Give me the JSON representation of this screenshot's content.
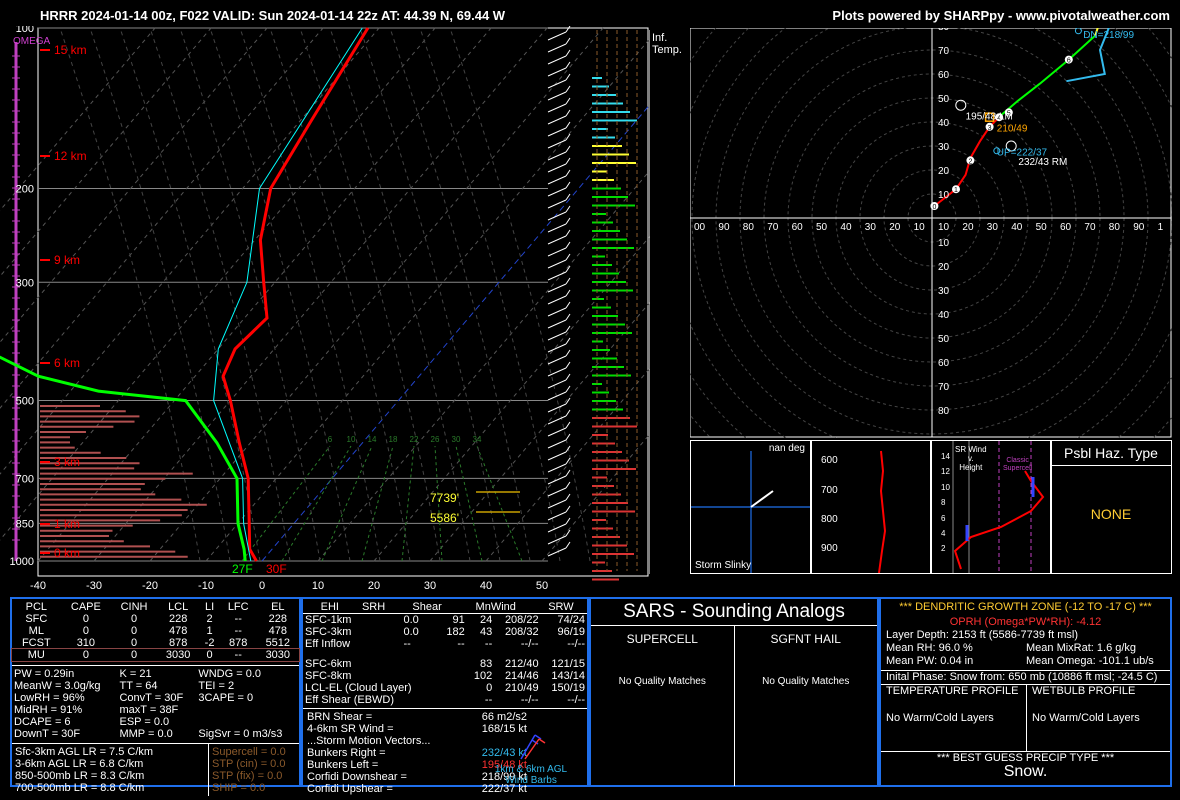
{
  "header": {
    "title": "HRRR 2024-01-14 00z, F022  VALID: Sun 2024-01-14 22z  AT: 44.39 N, 69.44 W",
    "credit": "Plots powered by SHARPpy - www.pivotalweather.com"
  },
  "skewt": {
    "omega_label": "OMEGA",
    "pressure_labels": [
      "100",
      "200",
      "300",
      "500",
      "700",
      "850",
      "1000"
    ],
    "height_labels": [
      "15 km",
      "12 km",
      "9 km",
      "6 km",
      "3 km",
      "1 km",
      "0 km"
    ],
    "temp_ticks": [
      "-40",
      "-30",
      "-20",
      "-10",
      "0",
      "10",
      "20",
      "30",
      "40",
      "50"
    ],
    "sfc_td": "27F",
    "sfc_t": "30F",
    "dgz_top": "7739'",
    "dgz_bottom": "5586'",
    "mixing_ratio_labels": [
      "6",
      "10",
      "14",
      "18",
      "22",
      "26",
      "30",
      "34"
    ]
  },
  "inferred_temp": {
    "title_line1": "Inf.",
    "title_line2": "Temp.",
    "values": [
      "3.5",
      "1.5",
      "3.1",
      "0.4",
      "3.9",
      "0.3",
      "-0.0",
      "0.6"
    ]
  },
  "hodograph": {
    "x_ticks": [
      "00",
      "90",
      "80",
      "70",
      "60",
      "50",
      "40",
      "30",
      "20",
      "10",
      "10",
      "20",
      "30",
      "40",
      "50",
      "60",
      "70",
      "80",
      "90",
      "1"
    ],
    "y_ticks": [
      "80",
      "70",
      "60",
      "50",
      "40",
      "30",
      "20",
      "10",
      "10",
      "20",
      "30",
      "40",
      "50",
      "60",
      "70",
      "80"
    ],
    "labels": {
      "dn": "DN=218/99",
      "lm": "195/48 LM",
      "mean": "210/49",
      "up": "UP=222/37",
      "rm": "232/43 RM"
    }
  },
  "storm_slinky": {
    "title": "Storm Slinky",
    "deg": "nan deg"
  },
  "theta_profile": {
    "levels": [
      "600",
      "700",
      "800",
      "900"
    ]
  },
  "sr_wind": {
    "title_l1": "SR Wind",
    "title_l2": "v.",
    "title_l3": "Height",
    "classic": "Classic",
    "supercell": "Supercell",
    "heights": [
      "14",
      "12",
      "10",
      "8",
      "6",
      "4",
      "2"
    ]
  },
  "hazard": {
    "title": "Psbl Haz. Type",
    "value": "NONE"
  },
  "parcels": {
    "headers": [
      "PCL",
      "CAPE",
      "CINH",
      "LCL",
      "LI",
      "LFC",
      "EL"
    ],
    "rows": [
      [
        "SFC",
        "0",
        "0",
        "228",
        "2",
        "--",
        "228"
      ],
      [
        "ML",
        "0",
        "0",
        "478",
        "1",
        "--",
        "478"
      ],
      [
        "FCST",
        "310",
        "0",
        "878",
        "-2",
        "878",
        "5512"
      ],
      [
        "MU",
        "0",
        "0",
        "3030",
        "0",
        "--",
        "3030"
      ]
    ]
  },
  "indices": [
    [
      "PW = 0.29in",
      "K = 21",
      "WNDG = 0.0"
    ],
    [
      "MeanW = 3.0g/kg",
      "TT = 64",
      "TEI = 2"
    ],
    [
      "LowRH = 96%",
      "ConvT = 30F",
      "3CAPE = 0"
    ],
    [
      "MidRH = 91%",
      "maxT = 38F",
      ""
    ],
    [
      "DCAPE = 6",
      "ESP = 0.0",
      ""
    ],
    [
      "DownT = 30F",
      "MMP = 0.0",
      "SigSvr = 0 m3/s3"
    ]
  ],
  "lapse_rates": [
    "Sfc-3km AGL LR = 7.5 C/km",
    "3-6km AGL LR = 6.8 C/km",
    "850-500mb LR = 8.3 C/km",
    "700-500mb LR = 8.8 C/km"
  ],
  "composite": [
    "Supercell = 0.0",
    "STP (cin) = 0.0",
    "STP (fix) = 0.0",
    "SHIP = 0.0"
  ],
  "kinematics": {
    "headers": [
      "",
      "EHI",
      "SRH",
      "Shear",
      "MnWind",
      "SRW"
    ],
    "rows": [
      [
        "SFC-1km",
        "0.0",
        "91",
        "24",
        "208/22",
        "74/24"
      ],
      [
        "SFC-3km",
        "0.0",
        "182",
        "43",
        "208/32",
        "96/19"
      ],
      [
        "Eff Inflow",
        "--",
        "--",
        "--",
        "--/--",
        "--/--"
      ],
      [
        "",
        "",
        "",
        "",
        "",
        ""
      ],
      [
        "SFC-6km",
        "",
        "",
        "83",
        "212/40",
        "121/15"
      ],
      [
        "SFC-8km",
        "",
        "",
        "102",
        "214/46",
        "143/14"
      ],
      [
        "LCL-EL (Cloud Layer)",
        "",
        "",
        "0",
        "210/49",
        "150/19"
      ],
      [
        "Eff Shear (EBWD)",
        "",
        "",
        "--",
        "--/--",
        "--/--"
      ]
    ],
    "brn_shear": "BRN Shear =",
    "brn_shear_val": "66 m2/s2",
    "sr_wind_46": "4-6km SR Wind =",
    "sr_wind_46_val": "168/15 kt",
    "storm_motion": "...Storm Motion Vectors...",
    "motion_rows": [
      [
        "Bunkers Right =",
        "232/43 kt"
      ],
      [
        "Bunkers Left =",
        "195/48 kt"
      ],
      [
        "Corfidi Downshear =",
        "218/99 kt"
      ],
      [
        "Corfidi Upshear =",
        "222/37 kt"
      ]
    ],
    "barbs_label_1": "1km & 6km AGL",
    "barbs_label_2": "Wind Barbs"
  },
  "sars": {
    "title": "SARS - Sounding Analogs",
    "supercell": "SUPERCELL",
    "hail": "SGFNT HAIL",
    "supercell_result": "No Quality Matches",
    "hail_result": "No Quality Matches"
  },
  "dgz": {
    "title": "*** DENDRITIC GROWTH ZONE (-12 TO -17 C) ***",
    "oprh": "OPRH (Omega*PW*RH): -4.12",
    "layer_depth": "Layer Depth: 2153 ft (5586-7739 ft msl)",
    "mean_rh": "Mean RH: 96.0 %",
    "mean_mixrat": "Mean MixRat: 1.6 g/kg",
    "mean_pw": "Mean PW: 0.04 in",
    "mean_omega": "Mean Omega: -101.1 ub/s",
    "initial_phase": "Inital Phase: Snow from: 650 mb (10886 ft msl; -24.5 C)",
    "temp_profile": "TEMPERATURE PROFILE",
    "wetbulb_profile": "WETBULB PROFILE",
    "temp_result": "No Warm/Cold Layers",
    "wetbulb_result": "No Warm/Cold Layers",
    "precip_title": "*** BEST GUESS PRECIP TYPE ***",
    "precip_value": "Snow."
  },
  "colors": {
    "temperature": "#ff0000",
    "dewpoint": "#00ff00",
    "wetbulb": "#00ffff",
    "hodo_cyan": "#33bbee",
    "orange": "#ffa500",
    "yellow": "#ffff33"
  },
  "chart_data": [
    {
      "type": "line",
      "title": "Skew-T",
      "ylabel": "Pressure (mb)",
      "xlabel": "Temperature (C)",
      "pressure_ticks": [
        100,
        200,
        300,
        500,
        700,
        850,
        1000
      ],
      "ylim": [
        1000,
        100
      ],
      "xlim": [
        -40,
        50
      ],
      "series": [
        {
          "name": "Temperature",
          "points": [
            [
              1000,
              -1
            ],
            [
              950,
              -4
            ],
            [
              850,
              -8
            ],
            [
              700,
              -15
            ],
            [
              600,
              -22
            ],
            [
              500,
              -30
            ],
            [
              450,
              -35
            ],
            [
              400,
              -37
            ],
            [
              350,
              -36
            ],
            [
              300,
              -42
            ],
            [
              250,
              -49
            ],
            [
              200,
              -55
            ],
            [
              150,
              -58
            ],
            [
              100,
              -62
            ]
          ]
        },
        {
          "name": "Dewpoint",
          "points": [
            [
              1000,
              -3
            ],
            [
              950,
              -5
            ],
            [
              850,
              -10
            ],
            [
              700,
              -17
            ],
            [
              600,
              -26
            ],
            [
              500,
              -38
            ],
            [
              480,
              -55
            ],
            [
              450,
              -68
            ],
            [
              400,
              -82
            ],
            [
              300,
              -95
            ],
            [
              200,
              -110
            ]
          ]
        },
        {
          "name": "Wetbulb",
          "points": [
            [
              1000,
              -2
            ],
            [
              850,
              -9
            ],
            [
              700,
              -16
            ],
            [
              500,
              -33
            ],
            [
              400,
              -40
            ],
            [
              300,
              -45
            ],
            [
              200,
              -57
            ],
            [
              100,
              -63
            ]
          ]
        }
      ]
    },
    {
      "type": "line",
      "title": "Hodograph",
      "xlim": [
        -100,
        100
      ],
      "ylim": [
        -80,
        80
      ],
      "series": [
        {
          "name": "0-3km",
          "points": [
            [
              1,
              5
            ],
            [
              10,
              12
            ],
            [
              14,
              18
            ],
            [
              16,
              25
            ],
            [
              20,
              32
            ],
            [
              24,
              38
            ],
            [
              29,
              43
            ]
          ]
        },
        {
          "name": "3-6km",
          "points": [
            [
              29,
              43
            ],
            [
              36,
              49
            ],
            [
              45,
              56
            ],
            [
              57,
              66
            ],
            [
              68,
              76
            ]
          ]
        },
        {
          "name": "6-9km",
          "points": [
            [
              68,
              76
            ],
            [
              70,
              82
            ],
            [
              74,
              80
            ]
          ]
        },
        {
          "name": "9-12km",
          "points": [
            [
              74,
              80
            ],
            [
              70,
              70
            ],
            [
              72,
              60
            ],
            [
              56,
              57
            ]
          ]
        }
      ]
    }
  ]
}
